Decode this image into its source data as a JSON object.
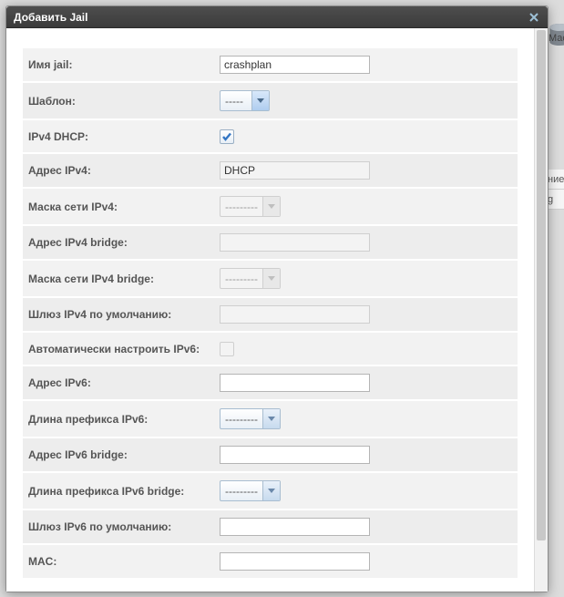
{
  "dialog": {
    "title": "Добавить Jail"
  },
  "background": {
    "icon_label": "Мас",
    "cell1": "ние",
    "cell2": "g"
  },
  "form": {
    "jail_name": {
      "label": "Имя jail:",
      "value": "crashplan"
    },
    "template": {
      "label": "Шаблон:",
      "value": "-----"
    },
    "ipv4_dhcp": {
      "label": "IPv4 DHCP:",
      "checked": true
    },
    "ipv4_addr": {
      "label": "Адрес IPv4:",
      "value": "DHCP",
      "disabled": true
    },
    "ipv4_mask": {
      "label": "Маска сети IPv4:",
      "value": "---------",
      "disabled": true
    },
    "ipv4_bridge_addr": {
      "label": "Адрес IPv4 bridge:",
      "value": "",
      "disabled": true
    },
    "ipv4_bridge_mask": {
      "label": "Маска сети IPv4 bridge:",
      "value": "---------",
      "disabled": true
    },
    "ipv4_gateway": {
      "label": "Шлюз IPv4 по умолчанию:",
      "value": "",
      "disabled": true
    },
    "ipv6_auto": {
      "label": "Автоматически настроить IPv6:",
      "checked": false,
      "disabled": true
    },
    "ipv6_addr": {
      "label": "Адрес IPv6:",
      "value": ""
    },
    "ipv6_prefix": {
      "label": "Длина префикса IPv6:",
      "value": "---------"
    },
    "ipv6_bridge_addr": {
      "label": "Адрес IPv6 bridge:",
      "value": ""
    },
    "ipv6_bridge_prefix": {
      "label": "Длина префикса IPv6 bridge:",
      "value": "---------"
    },
    "ipv6_gateway": {
      "label": "Шлюз IPv6 по умолчанию:",
      "value": ""
    },
    "mac": {
      "label": "MAC:",
      "value": ""
    }
  }
}
